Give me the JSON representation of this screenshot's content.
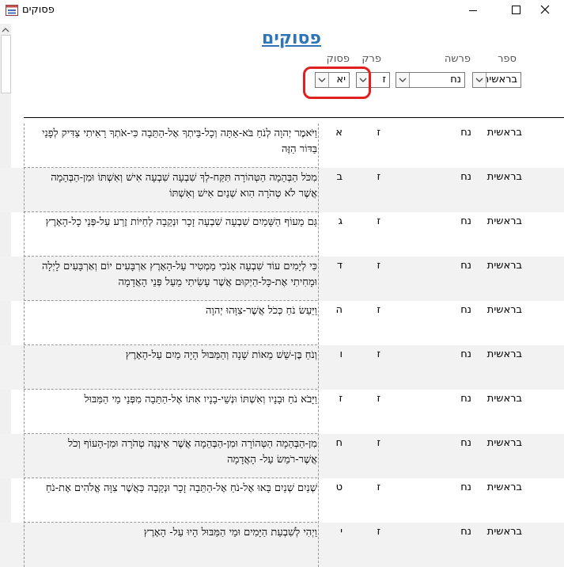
{
  "window": {
    "title": "פסוקים"
  },
  "form": {
    "title": "פסוקים"
  },
  "labels": {
    "book": "ספר",
    "parsha": "פרשה",
    "perek": "פרק",
    "pasuk": "פסוק"
  },
  "filters": {
    "book": "בראשית",
    "parsha": "נח",
    "perek": "ז",
    "pasuk": "יא"
  },
  "rows": [
    {
      "book": "בראשית",
      "parsha": "נח",
      "perek": "ז",
      "pasuk": "א",
      "text": "וַיֹּאמֶר יְהוָה לְנֹחַ בֹּא-אַתָּה וְכָל-בֵּיתְךָ אֶל-הַתֵּבָה כִּי-אֹתְךָ רָאִיתִי צַדִּיק לְפָנַי בַּדּוֹר הַזֶּה"
    },
    {
      "book": "בראשית",
      "parsha": "נח",
      "perek": "ז",
      "pasuk": "ב",
      "text": "מִכֹּל הַבְּהֵמָה הַטְּהוֹרָה תִּקַּח-לְךָ שִׁבְעָה שִׁבְעָה אִישׁ וְאִשְׁתּוֹ וּמִן-הַבְּהֵמָה אֲשֶׁר לֹא טְהֹרָה הִוא שְׁנַיִם אִישׁ וְאִשְׁתּוֹ"
    },
    {
      "book": "בראשית",
      "parsha": "נח",
      "perek": "ז",
      "pasuk": "ג",
      "text": "גַּם מֵעוֹף הַשָּׁמַיִם שִׁבְעָה שִׁבְעָה זָכָר וּנְקֵבָה לְחַיּוֹת זֶרַע עַל-פְּנֵי כָל-הָאָרֶץ"
    },
    {
      "book": "בראשית",
      "parsha": "נח",
      "perek": "ז",
      "pasuk": "ד",
      "text": "כִּי לְיָמִים עוֹד שִׁבְעָה אָנֹכִי מַמְטִיר עַל-הָאָרֶץ אַרְבָּעִים יוֹם וְאַרְבָּעִים לָיְלָה וּמָחִיתִי אֶת-כָּל-הַיְקוּם אֲשֶׁר עָשִׂיתִי מֵעַל פְּנֵי הָאֲדָמָה"
    },
    {
      "book": "בראשית",
      "parsha": "נח",
      "perek": "ז",
      "pasuk": "ה",
      "text": "וַיַּעַשׂ נֹחַ כְּכֹל אֲשֶׁר-צִוָּהוּ יְהוָה"
    },
    {
      "book": "בראשית",
      "parsha": "נח",
      "perek": "ז",
      "pasuk": "ו",
      "text": "וְנֹחַ בֶּן-שֵׁשׁ מֵאוֹת שָׁנָה וְהַמַּבּוּל הָיָה מַיִם עַל-הָאָרֶץ"
    },
    {
      "book": "בראשית",
      "parsha": "נח",
      "perek": "ז",
      "pasuk": "ז",
      "text": "וַיָּבֹא נֹחַ וּבָנָיו וְאִשְׁתּוֹ וּנְשֵׁי-בָנָיו אִתּוֹ אֶל-הַתֵּבָה מִפְּנֵי מֵי הַמַּבּוּל"
    },
    {
      "book": "בראשית",
      "parsha": "נח",
      "perek": "ז",
      "pasuk": "ח",
      "text": "מִן-הַבְּהֵמָה הַטְּהוֹרָה וּמִן-הַבְּהֵמָה אֲשֶׁר אֵינֶנָּה טְהֹרָה וּמִן-הָעוֹף וְכֹל אֲשֶׁר-רֹמֵשׂ עַל- הָאֲדָמָה"
    },
    {
      "book": "בראשית",
      "parsha": "נח",
      "perek": "ז",
      "pasuk": "ט",
      "text": "שְׁנַיִם שְׁנַיִם בָּאוּ אֶל-נֹחַ אֶל-הַתֵּבָה זָכָר וּנְקֵבָה כַּאֲשֶׁר צִוָּה אֱלֹהִים אֶת-נֹחַ"
    },
    {
      "book": "בראשית",
      "parsha": "נח",
      "perek": "ז",
      "pasuk": "י",
      "text": "וַיְהִי לְשִׁבְעַת הַיָּמִים וּמֵי הַמַּבּוּל הָיוּ עַל- הָאָרֶץ"
    }
  ]
}
